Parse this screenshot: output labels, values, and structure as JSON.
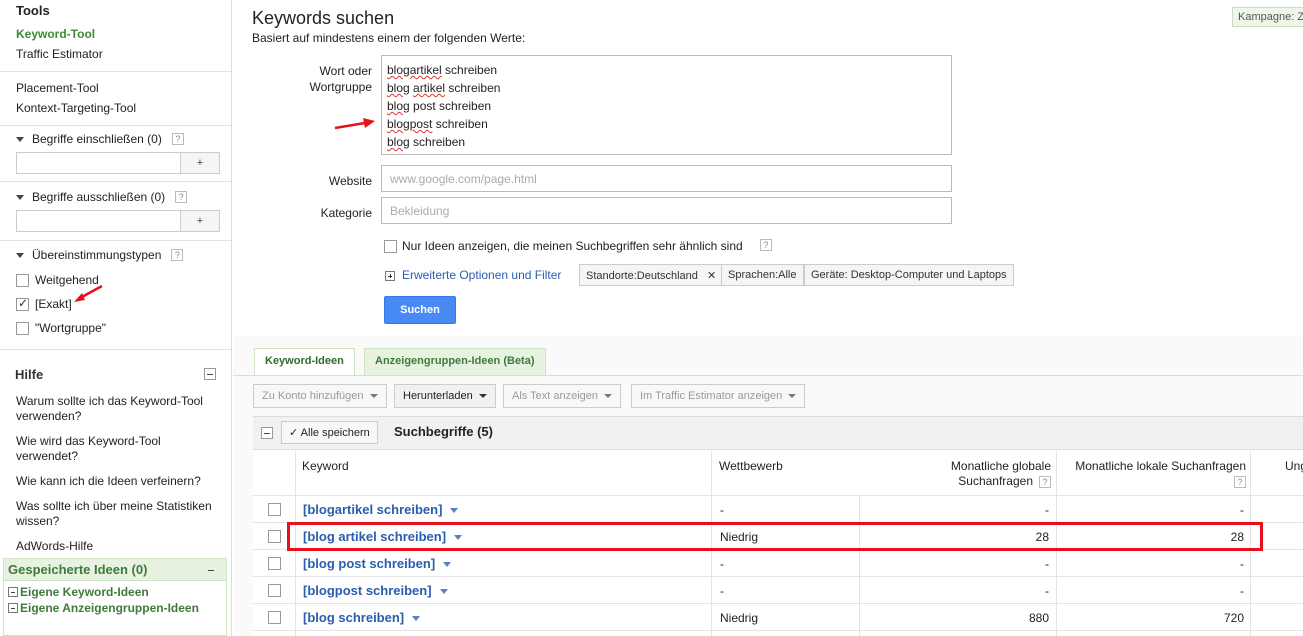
{
  "sidebar": {
    "tools_title": "Tools",
    "tools": [
      "Keyword-Tool",
      "Traffic Estimator"
    ],
    "tools2": [
      "Placement-Tool",
      "Kontext-Targeting-Tool"
    ],
    "include_title": "Begriffe einschließen (0)",
    "include_add": "+",
    "exclude_title": "Begriffe ausschließen (0)",
    "exclude_add": "+",
    "match_title": "Übereinstimmungstypen",
    "match_types": [
      {
        "label": "Weitgehend",
        "checked": false
      },
      {
        "label": "[Exakt]",
        "checked": true
      },
      {
        "label": "\"Wortgruppe\"",
        "checked": false
      }
    ],
    "help_title": "Hilfe",
    "help_items": [
      "Warum sollte ich das Keyword-Tool verwenden?",
      "Wie wird das Keyword-Tool verwendet?",
      "Wie kann ich die Ideen verfeinern?",
      "Was sollte ich über meine Statistiken wissen?"
    ],
    "adwords_help": "AdWords-Hilfe",
    "saved_title": "Gespeicherte Ideen (0)",
    "saved_items": [
      "Eigene Keyword-Ideen",
      "Eigene Anzeigengruppen-Ideen"
    ]
  },
  "header": {
    "title": "Keywords suchen",
    "subtitle": "Basiert auf mindestens einem der folgenden Werte:",
    "kampagne": "Kampagne: Z"
  },
  "form": {
    "word_label_1": "Wort oder",
    "word_label_2": "Wortgruppe",
    "words": [
      {
        "a": "blogartikel",
        "b": " schreiben"
      },
      {
        "a": "blog",
        "b": " ",
        "c": "artikel",
        "d": " schreiben"
      },
      {
        "a": "blog",
        "b": " post schreiben"
      },
      {
        "a": "blogpost",
        "b": " schreiben"
      },
      {
        "a": "blog",
        "b": " schreiben"
      }
    ],
    "website_label": "Website",
    "website_placeholder": "www.google.com/page.html",
    "category_label": "Kategorie",
    "category_placeholder": "Bekleidung",
    "similar_only": "Nur Ideen anzeigen, die meinen Suchbegriffen sehr ähnlich sind",
    "advanced": "Erweiterte Optionen und Filter",
    "chips": [
      "Standorte:Deutschland",
      "Sprachen:Alle",
      "Geräte: Desktop-Computer und Laptops"
    ],
    "chip_close": "✕",
    "search_button": "Suchen"
  },
  "results": {
    "tabs": [
      "Keyword-Ideen",
      "Anzeigengruppen-Ideen (Beta)"
    ],
    "toolbar": [
      "Zu Konto hinzufügen",
      "Herunterladen",
      "Als Text anzeigen",
      "Im Traffic Estimator anzeigen"
    ],
    "save_all": "Alle speichern",
    "section_title": "Suchbegriffe (5)",
    "columns": {
      "keyword": "Keyword",
      "competition": "Wettbewerb",
      "global_1": "Monatliche globale",
      "global_2": "Suchanfragen",
      "local": "Monatliche lokale Suchanfragen",
      "extra": "Ung"
    },
    "rows": [
      {
        "keyword": "[blogartikel schreiben]",
        "competition": "-",
        "global": "-",
        "local": "-"
      },
      {
        "keyword": "[blog artikel schreiben]",
        "competition": "Niedrig",
        "global": "28",
        "local": "28"
      },
      {
        "keyword": "[blog post schreiben]",
        "competition": "-",
        "global": "-",
        "local": "-"
      },
      {
        "keyword": "[blogpost schreiben]",
        "competition": "-",
        "global": "-",
        "local": "-"
      },
      {
        "keyword": "[blog schreiben]",
        "competition": "Niedrig",
        "global": "880",
        "local": "720"
      }
    ]
  },
  "colors": {
    "accent_green": "#3f8a34",
    "link_blue": "#2a5db0",
    "search_button": "#4a8af4",
    "highlight_red": "#e8101a"
  }
}
